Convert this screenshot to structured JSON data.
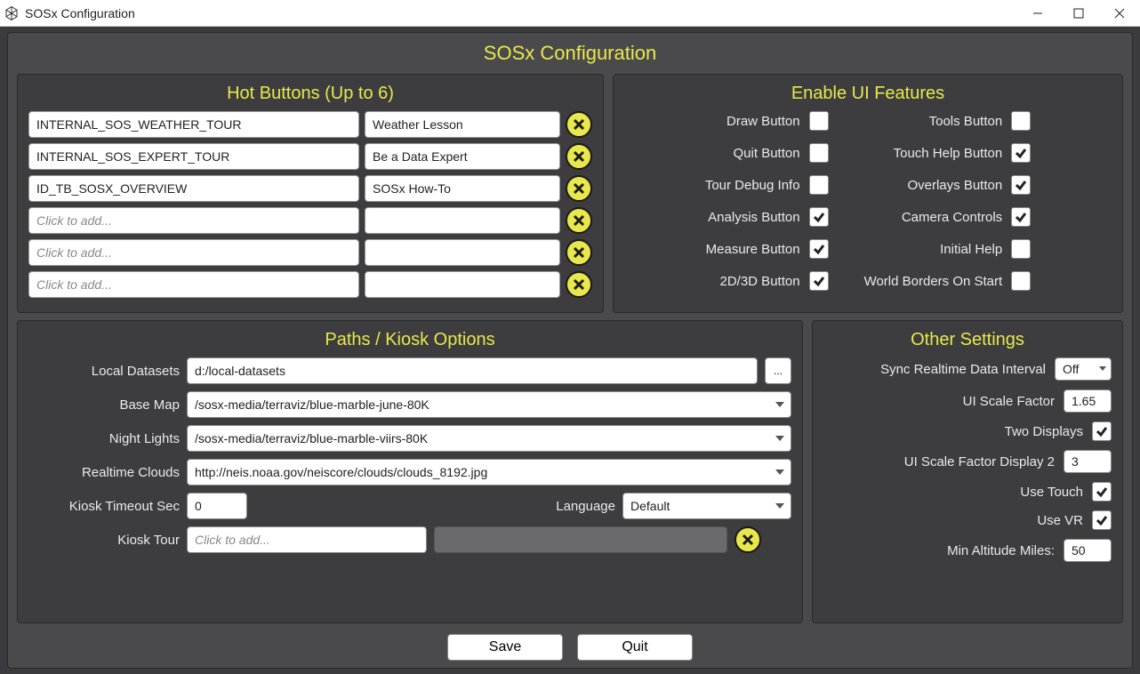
{
  "window": {
    "title": "SOSx Configuration"
  },
  "app_title": "SOSx Configuration",
  "hot_buttons": {
    "title": "Hot Buttons (Up to 6)",
    "placeholder": "Click to add...",
    "rows": [
      {
        "id": "INTERNAL_SOS_WEATHER_TOUR",
        "label": "Weather Lesson"
      },
      {
        "id": "INTERNAL_SOS_EXPERT_TOUR",
        "label": "Be a Data Expert"
      },
      {
        "id": "ID_TB_SOSX_OVERVIEW",
        "label": "SOSx How-To"
      },
      {
        "id": "",
        "label": ""
      },
      {
        "id": "",
        "label": ""
      },
      {
        "id": "",
        "label": ""
      }
    ]
  },
  "ui_features": {
    "title": "Enable UI Features",
    "left": [
      {
        "label": "Draw Button",
        "checked": false
      },
      {
        "label": "Quit Button",
        "checked": false
      },
      {
        "label": "Tour Debug Info",
        "checked": false
      },
      {
        "label": "Analysis Button",
        "checked": true
      },
      {
        "label": "Measure Button",
        "checked": true
      },
      {
        "label": "2D/3D Button",
        "checked": true
      }
    ],
    "right": [
      {
        "label": "Tools Button",
        "checked": false
      },
      {
        "label": "Touch Help Button",
        "checked": true
      },
      {
        "label": "Overlays Button",
        "checked": true
      },
      {
        "label": "Camera Controls",
        "checked": true
      },
      {
        "label": "Initial Help",
        "checked": false
      },
      {
        "label": "World Borders On Start",
        "checked": false
      }
    ]
  },
  "paths": {
    "title": "Paths / Kiosk Options",
    "local_datasets": {
      "label": "Local Datasets",
      "value": "d:/local-datasets",
      "browse": "..."
    },
    "base_map": {
      "label": "Base Map",
      "value": "/sosx-media/terraviz/blue-marble-june-80K"
    },
    "night_lights": {
      "label": "Night Lights",
      "value": "/sosx-media/terraviz/blue-marble-viirs-80K"
    },
    "realtime_clouds": {
      "label": "Realtime Clouds",
      "value": "http://neis.noaa.gov/neiscore/clouds/clouds_8192.jpg"
    },
    "kiosk_timeout": {
      "label": "Kiosk Timeout Sec",
      "value": "0"
    },
    "language": {
      "label": "Language",
      "value": "Default"
    },
    "kiosk_tour": {
      "label": "Kiosk Tour",
      "placeholder": "Click to add..."
    }
  },
  "other": {
    "title": "Other Settings",
    "sync_interval": {
      "label": "Sync Realtime Data Interval",
      "value": "Off"
    },
    "ui_scale": {
      "label": "UI Scale Factor",
      "value": "1.65"
    },
    "two_displays": {
      "label": "Two Displays",
      "checked": true
    },
    "ui_scale_d2": {
      "label": "UI Scale Factor Display 2",
      "value": "3"
    },
    "use_touch": {
      "label": "Use Touch",
      "checked": true
    },
    "use_vr": {
      "label": "Use VR",
      "checked": true
    },
    "min_altitude": {
      "label": "Min Altitude Miles:",
      "value": "50"
    }
  },
  "buttons": {
    "save": "Save",
    "quit": "Quit"
  }
}
